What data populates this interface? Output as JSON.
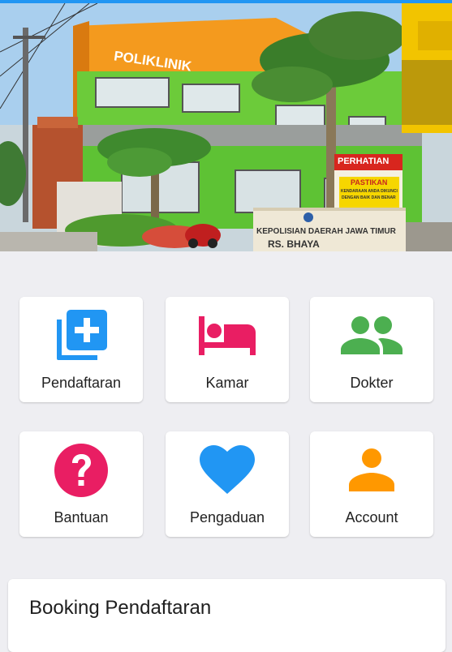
{
  "colors": {
    "accent_blue": "#2196f3",
    "pink": "#e91e63",
    "green": "#4caf50",
    "orange": "#ff9800",
    "background": "#eeeef2"
  },
  "banner": {
    "building_sign": "POLIKLINIK",
    "notice_title": "PERHATIAN",
    "notice_word": "PASTIKAN",
    "notice_line1": "KENDARAAN ANDA DIKUNCI",
    "notice_line2": "DENGAN BAIK DAN BENAR",
    "institution_line1": "KEPOLISIAN DAERAH JAWA TIMUR",
    "institution_line2": "RS. BHAYA"
  },
  "menu": [
    {
      "label": "Pendaftaran",
      "icon": "add-to-list-icon",
      "color": "#2196f3"
    },
    {
      "label": "Kamar",
      "icon": "bed-icon",
      "color": "#e91e63"
    },
    {
      "label": "Dokter",
      "icon": "people-icon",
      "color": "#4caf50"
    },
    {
      "label": "Bantuan",
      "icon": "help-circle-icon",
      "color": "#e91e63"
    },
    {
      "label": "Pengaduan",
      "icon": "heart-icon",
      "color": "#2196f3"
    },
    {
      "label": "Account",
      "icon": "person-icon",
      "color": "#ff9800"
    }
  ],
  "booking": {
    "title": "Booking Pendaftaran"
  }
}
